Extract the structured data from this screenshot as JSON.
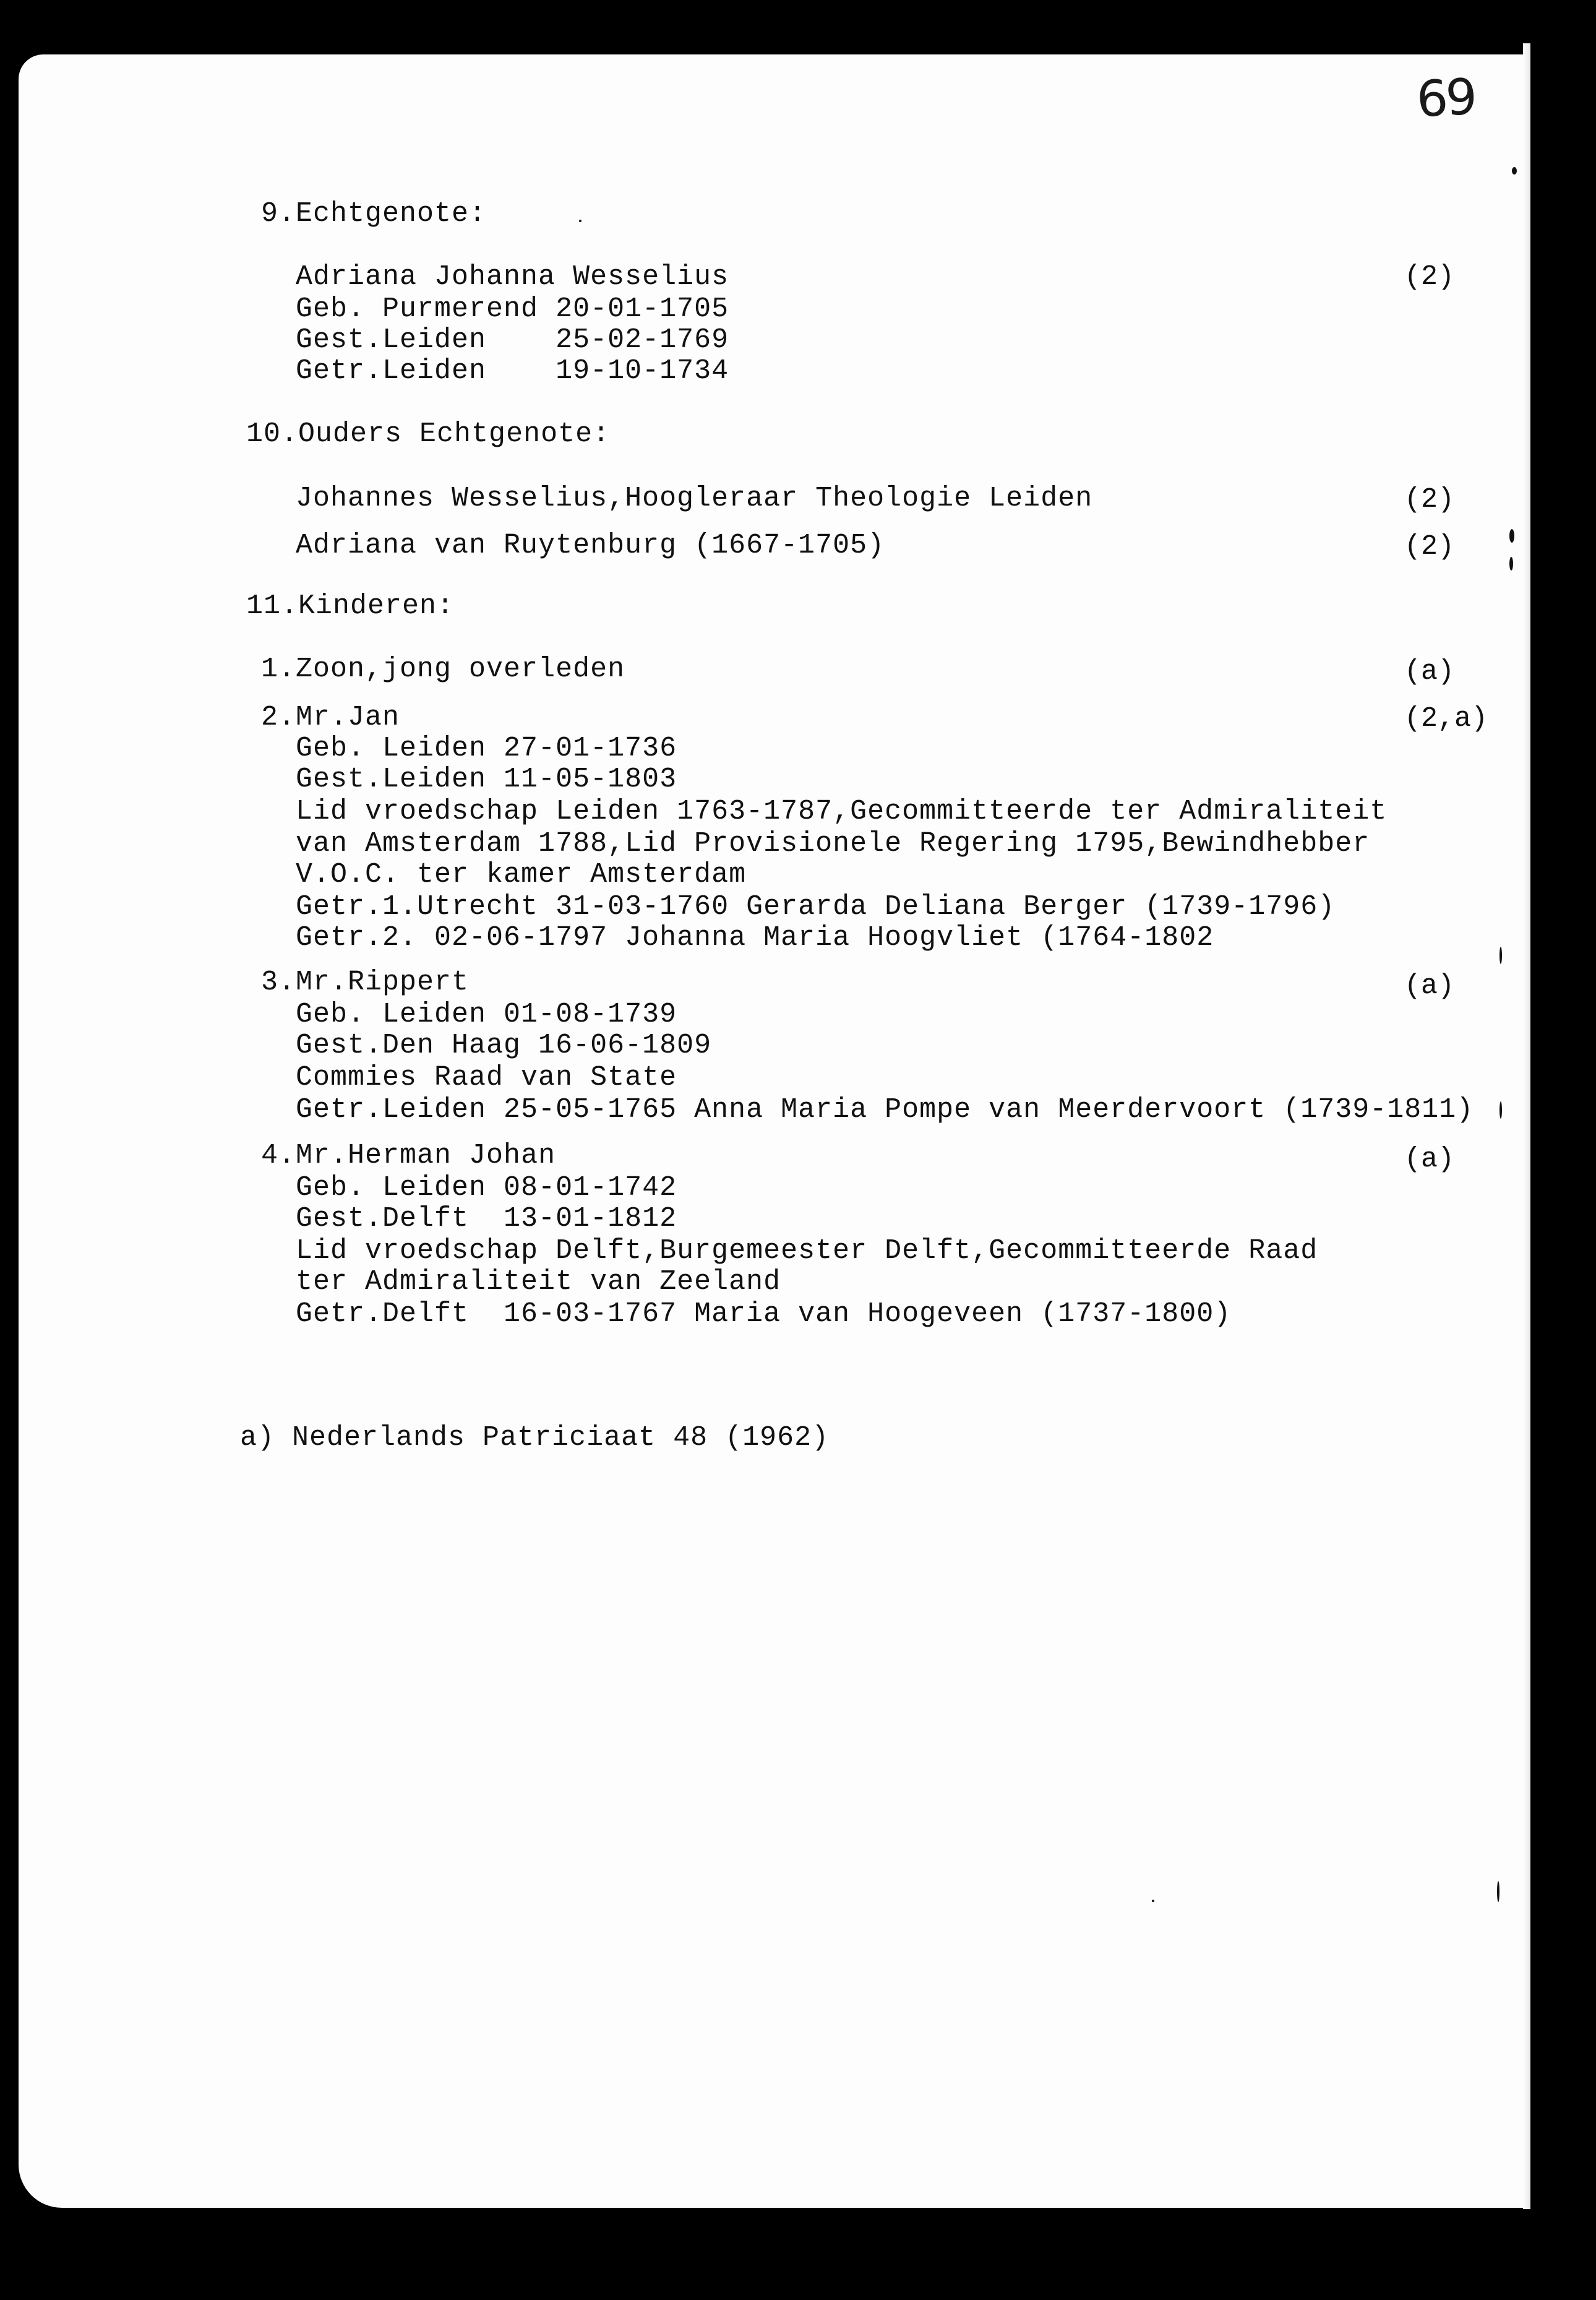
{
  "page_number": "69",
  "spouse": {
    "heading": "9.Echtgenote:",
    "name": "Adriana Johanna Wesselius",
    "ref": "(2)",
    "born": "Geb. Purmerend 20-01-1705",
    "died": "Gest.Leiden    25-02-1769",
    "married": "Getr.Leiden    19-10-1734"
  },
  "parents": {
    "heading": "10.Ouders Echtgenote:",
    "father": "Johannes Wesselius,Hoogleraar Theologie Leiden",
    "father_ref": "(2)",
    "mother": "Adriana van Ruytenburg (1667-1705)",
    "mother_ref": "(2)"
  },
  "children": {
    "heading": "11.Kinderen:",
    "c1": {
      "title": "1.Zoon,jong overleden",
      "ref": "(a)"
    },
    "c2": {
      "title": "2.Mr.Jan",
      "ref": "(2,a)",
      "lines": [
        "Geb. Leiden 27-01-1736",
        "Gest.Leiden 11-05-1803",
        "Lid vroedschap Leiden 1763-1787,Gecommitteerde ter Admiraliteit",
        "van Amsterdam 1788,Lid Provisionele Regering 1795,Bewindhebber",
        "V.O.C. ter kamer Amsterdam",
        "Getr.1.Utrecht 31-03-1760 Gerarda Deliana Berger (1739-1796)",
        "Getr.2. 02-06-1797 Johanna Maria Hoogvliet (1764-1802"
      ]
    },
    "c3": {
      "title": "3.Mr.Rippert",
      "ref": "(a)",
      "lines": [
        "Geb. Leiden 01-08-1739",
        "Gest.Den Haag 16-06-1809",
        "Commies Raad van State",
        "Getr.Leiden 25-05-1765 Anna Maria Pompe van Meerdervoort (1739-1811)"
      ]
    },
    "c4": {
      "title": "4.Mr.Herman Johan",
      "ref": "(a)",
      "lines": [
        "Geb. Leiden 08-01-1742",
        "Gest.Delft  13-01-1812",
        "Lid vroedschap Delft,Burgemeester Delft,Gecommitteerde Raad",
        "ter Admiraliteit van Zeeland",
        "Getr.Delft  16-03-1767 Maria van Hoogeveen (1737-1800)"
      ]
    }
  },
  "footnote": "a) Nederlands Patriciaat 48 (1962)"
}
